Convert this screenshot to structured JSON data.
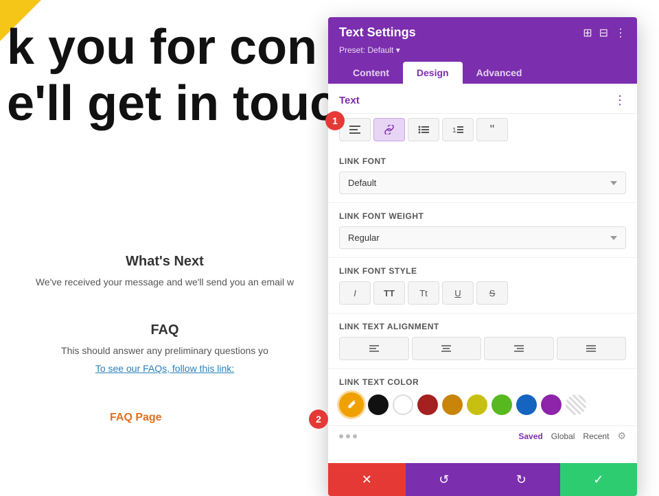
{
  "background": {
    "headline_line1": "k you for con",
    "headline_line2": "e'll get in touc",
    "section_title": "What's Next",
    "section_text": "We've received your message and we'll send you an email w",
    "faq_title": "FAQ",
    "faq_text": "This should answer any preliminary questions yo",
    "faq_link_text": "To see our FAQs, follow this link:",
    "faq_page_label": "FAQ Page"
  },
  "panel": {
    "title": "Text Settings",
    "preset_label": "Preset: Default",
    "tabs": [
      {
        "id": "content",
        "label": "Content",
        "active": false
      },
      {
        "id": "design",
        "label": "Design",
        "active": true
      },
      {
        "id": "advanced",
        "label": "Advanced",
        "active": false
      }
    ],
    "section_title": "Text",
    "badge1": "1",
    "badge2": "2",
    "toolbar_buttons": [
      {
        "id": "align",
        "icon": "≡",
        "active": false
      },
      {
        "id": "link",
        "icon": "🔗",
        "active": true
      },
      {
        "id": "list-ul",
        "icon": "☰",
        "active": false
      },
      {
        "id": "list-ol",
        "icon": "≔",
        "active": false
      },
      {
        "id": "quote",
        "icon": "❝",
        "active": false
      }
    ],
    "link_font_label": "Link Font",
    "link_font_value": "Default",
    "link_font_weight_label": "Link Font Weight",
    "link_font_weight_value": "Regular",
    "link_font_style_label": "Link Font Style",
    "font_style_buttons": [
      {
        "id": "italic",
        "label": "I",
        "style": "italic"
      },
      {
        "id": "bold_tt",
        "label": "TT",
        "style": "bold"
      },
      {
        "id": "thin_tt",
        "label": "Tt",
        "style": "normal"
      },
      {
        "id": "underline",
        "label": "U",
        "style": "underline"
      },
      {
        "id": "strike",
        "label": "S",
        "style": "strike"
      }
    ],
    "link_text_align_label": "Link Text Alignment",
    "align_buttons": [
      {
        "id": "left",
        "icon": "≡"
      },
      {
        "id": "center",
        "icon": "≡"
      },
      {
        "id": "right",
        "icon": "≡"
      },
      {
        "id": "justify",
        "icon": "≡"
      }
    ],
    "link_text_color_label": "Link Text Color",
    "color_swatches": [
      {
        "id": "custom",
        "type": "edit",
        "bg": "#f0a000"
      },
      {
        "id": "black",
        "bg": "#111111"
      },
      {
        "id": "white",
        "bg": "#ffffff",
        "outline": true
      },
      {
        "id": "red",
        "bg": "#a52020"
      },
      {
        "id": "orange",
        "bg": "#c8850a"
      },
      {
        "id": "yellow",
        "bg": "#c8c010"
      },
      {
        "id": "green",
        "bg": "#58b820"
      },
      {
        "id": "blue",
        "bg": "#1565c0"
      },
      {
        "id": "purple",
        "bg": "#8e24aa"
      },
      {
        "id": "none",
        "type": "striped"
      }
    ],
    "color_footer": {
      "saved_label": "Saved",
      "global_label": "Global",
      "recent_label": "Recent"
    },
    "footer_buttons": [
      {
        "id": "cancel",
        "icon": "✕",
        "type": "cancel"
      },
      {
        "id": "undo",
        "icon": "↺",
        "type": "undo"
      },
      {
        "id": "redo",
        "icon": "↻",
        "type": "redo"
      },
      {
        "id": "save",
        "icon": "✓",
        "type": "save"
      }
    ]
  },
  "colors": {
    "purple": "#7b2ead",
    "red": "#e53935",
    "green": "#2ecc71",
    "orange": "#f0a000"
  }
}
